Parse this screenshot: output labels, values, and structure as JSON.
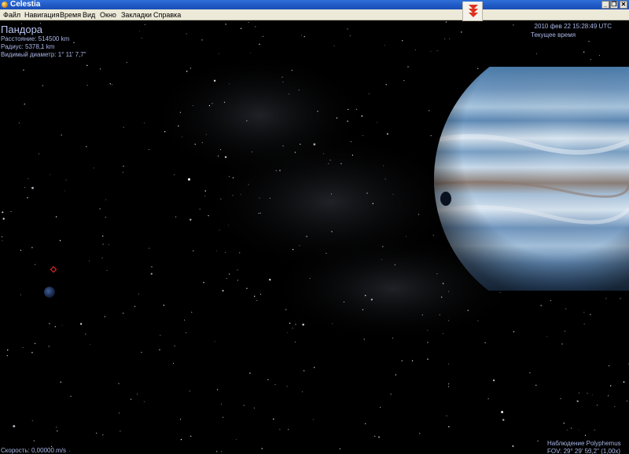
{
  "window": {
    "title": "Celestia",
    "controls": {
      "minimize": "_",
      "maximize": "❐",
      "close": "✕"
    }
  },
  "menu": {
    "items": [
      "Файл",
      "Навигация",
      "Время",
      "Вид",
      "Окно",
      "Закладки",
      "Справка"
    ]
  },
  "toolbar": {
    "collapse_icon": "double-chevron-down-icon",
    "accent": "#e0301e"
  },
  "selected_object": {
    "name": "Пандора",
    "distance": "Расстояние: 514500 km",
    "radius": "Радиус: 5378,1 km",
    "apparent_diameter": "Видимый диаметр: 1° 11' 7,7\""
  },
  "time": {
    "datetime": "2010 фев 22 15:28:49 UTC",
    "mode": "Текущее время"
  },
  "status": {
    "speed": "Скорость: 0,00000 m/s",
    "observer": "Наблюдение Polyphemus",
    "fov": "FOV: 29° 29' 53,2\" (1,00x)"
  },
  "colors": {
    "hud_text": "#a9b6e6",
    "planet_light": "#d8e6f2",
    "planet_mid": "#6f97bf",
    "planet_dark": "#2c4c73",
    "selection": "#ff2a2a"
  }
}
